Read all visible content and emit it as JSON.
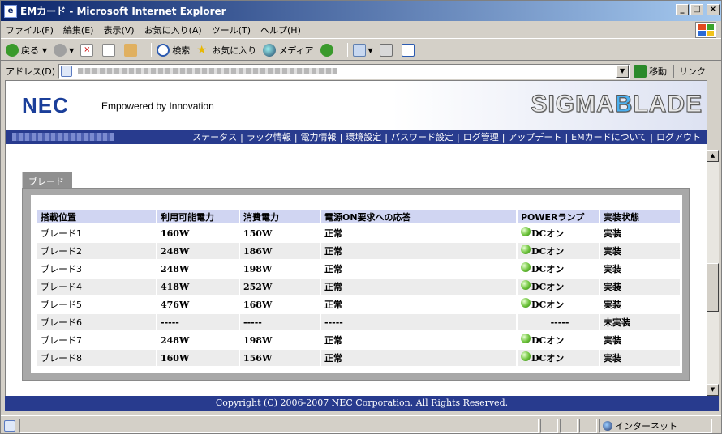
{
  "window": {
    "title": "EMカード - Microsoft Internet Explorer",
    "controls": {
      "minimize": "_",
      "maximize": "□",
      "close": "×"
    }
  },
  "menubar": {
    "items": [
      "ファイル(F)",
      "編集(E)",
      "表示(V)",
      "お気に入り(A)",
      "ツール(T)",
      "ヘルプ(H)"
    ]
  },
  "toolbar": {
    "back_label": "戻る",
    "search_label": "検索",
    "favorites_label": "お気に入り",
    "media_label": "メディア"
  },
  "addressbar": {
    "label": "アドレス(D)",
    "go_label": "移動",
    "links_label": "リンク"
  },
  "header": {
    "logo": "NEC",
    "tagline": "Empowered by Innovation",
    "product_logo_pre": "SIGMA",
    "product_logo_accent": "B",
    "product_logo_post": "LADE"
  },
  "nav": {
    "items": [
      "ステータス",
      "ラック情報",
      "電力情報",
      "環境設定",
      "パスワード設定",
      "ログ管理",
      "アップデート",
      "EMカードについて",
      "ログアウト"
    ],
    "separator": "|"
  },
  "panel": {
    "tab_label": "ブレード"
  },
  "table": {
    "headers": [
      "搭載位置",
      "利用可能電力",
      "消費電力",
      "電源ON要求への応答",
      "POWERランプ",
      "実装状態"
    ],
    "rows": [
      {
        "slot": "ブレード1",
        "available": "160W",
        "consumed": "150W",
        "response": "正常",
        "lamp": "DCオン",
        "state": "実装"
      },
      {
        "slot": "ブレード2",
        "available": "248W",
        "consumed": "186W",
        "response": "正常",
        "lamp": "DCオン",
        "state": "実装"
      },
      {
        "slot": "ブレード3",
        "available": "248W",
        "consumed": "198W",
        "response": "正常",
        "lamp": "DCオン",
        "state": "実装"
      },
      {
        "slot": "ブレード4",
        "available": "418W",
        "consumed": "252W",
        "response": "正常",
        "lamp": "DCオン",
        "state": "実装"
      },
      {
        "slot": "ブレード5",
        "available": "476W",
        "consumed": "168W",
        "response": "正常",
        "lamp": "DCオン",
        "state": "実装"
      },
      {
        "slot": "ブレード6",
        "available": "-----",
        "consumed": "-----",
        "response": "-----",
        "lamp": "-----",
        "state": "未実装"
      },
      {
        "slot": "ブレード7",
        "available": "248W",
        "consumed": "198W",
        "response": "正常",
        "lamp": "DCオン",
        "state": "実装"
      },
      {
        "slot": "ブレード8",
        "available": "160W",
        "consumed": "156W",
        "response": "正常",
        "lamp": "DCオン",
        "state": "実装"
      }
    ]
  },
  "footer": {
    "copyright": "Copyright (C) 2006-2007 NEC Corporation. All Rights Reserved."
  },
  "statusbar": {
    "zone": "インターネット"
  },
  "colors": {
    "nav_bg": "#283b8e",
    "header_row_bg": "#d0d5f2",
    "lamp_green": "#6cc23a"
  }
}
